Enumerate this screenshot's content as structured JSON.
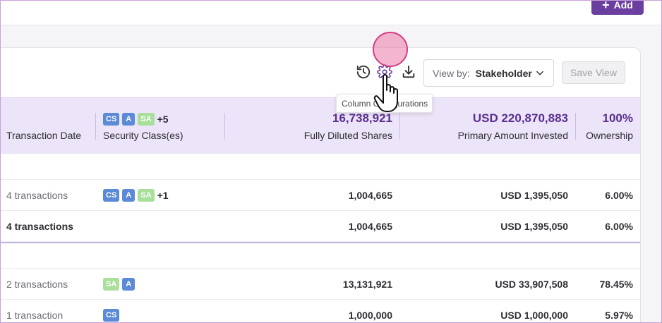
{
  "topbar": {
    "add_label": "Add"
  },
  "toolbar": {
    "history_icon": "history-icon",
    "settings_icon": "gear-icon",
    "download_icon": "download-icon",
    "viewby_label": "View by:",
    "viewby_value": "Stakeholder",
    "save_view_label": "Save View"
  },
  "tooltip": {
    "text": "Column Configurations"
  },
  "header": {
    "transaction_date": "Transaction Date",
    "security_classes": "Security Class(es)",
    "security_badges": [
      "CS",
      "A",
      "SA"
    ],
    "security_more": "+5",
    "fully_diluted_total": "16,738,921",
    "fully_diluted_label": "Fully Diluted Shares",
    "primary_amount_total": "USD 220,870,883",
    "primary_amount_label": "Primary Amount Invested",
    "ownership_total": "100%",
    "ownership_label": "Ownership"
  },
  "rows": [
    {
      "transactions": "4 transactions",
      "badges": [
        "CS",
        "A",
        "SA"
      ],
      "more": "+1",
      "shares": "1,004,665",
      "amount": "USD 1,395,050",
      "ownership": "6.00%"
    },
    {
      "transactions": "4 transactions",
      "badges": [],
      "more": "",
      "shares": "1,004,665",
      "amount": "USD 1,395,050",
      "ownership": "6.00%"
    },
    {
      "transactions": "2 transactions",
      "badges": [
        "SA",
        "A"
      ],
      "more": "",
      "shares": "13,131,921",
      "amount": "USD 33,907,508",
      "ownership": "78.45%"
    },
    {
      "transactions": "1 transaction",
      "badges": [
        "CS"
      ],
      "more": "",
      "shares": "1,000,000",
      "amount": "USD 1,000,000",
      "ownership": "5.97%"
    }
  ],
  "colors": {
    "accent": "#6b3fa0",
    "header_bg": "#ece4f8",
    "badge_blue": "#5b8ad6",
    "badge_green": "#a8df9a"
  }
}
